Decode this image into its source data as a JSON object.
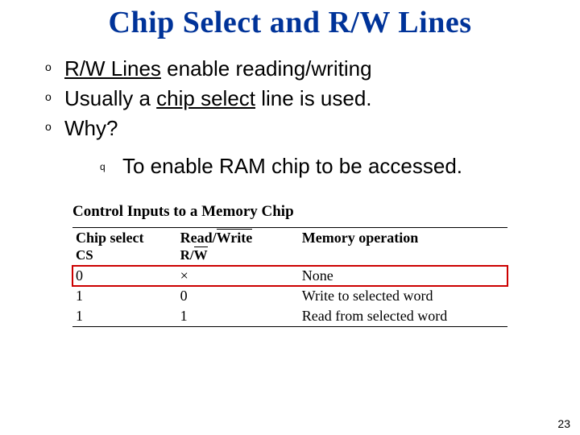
{
  "title": "Chip Select and R/W Lines",
  "bullets": {
    "b1_pre": "",
    "b1_u": "R/W Lines",
    "b1_post": " enable reading/writing",
    "b2_pre": "Usually a ",
    "b2_u": "chip select",
    "b2_post": " line is used.",
    "b3": "Why?"
  },
  "sub": {
    "s1": "To enable RAM chip to be accessed."
  },
  "table": {
    "caption": "Control Inputs to a Memory Chip",
    "headers": {
      "cs_top": "Chip select",
      "cs_sub": "CS",
      "rw_top": "Read/",
      "rw_top2": "Write",
      "rw_sub_pre": "R/",
      "rw_sub_bar": "W",
      "op": "Memory operation"
    },
    "rows": [
      {
        "cs": "0",
        "rw": "×",
        "op": "None"
      },
      {
        "cs": "1",
        "rw": "0",
        "op": "Write to selected word"
      },
      {
        "cs": "1",
        "rw": "1",
        "op": "Read from selected word"
      }
    ]
  },
  "page_number": "23"
}
